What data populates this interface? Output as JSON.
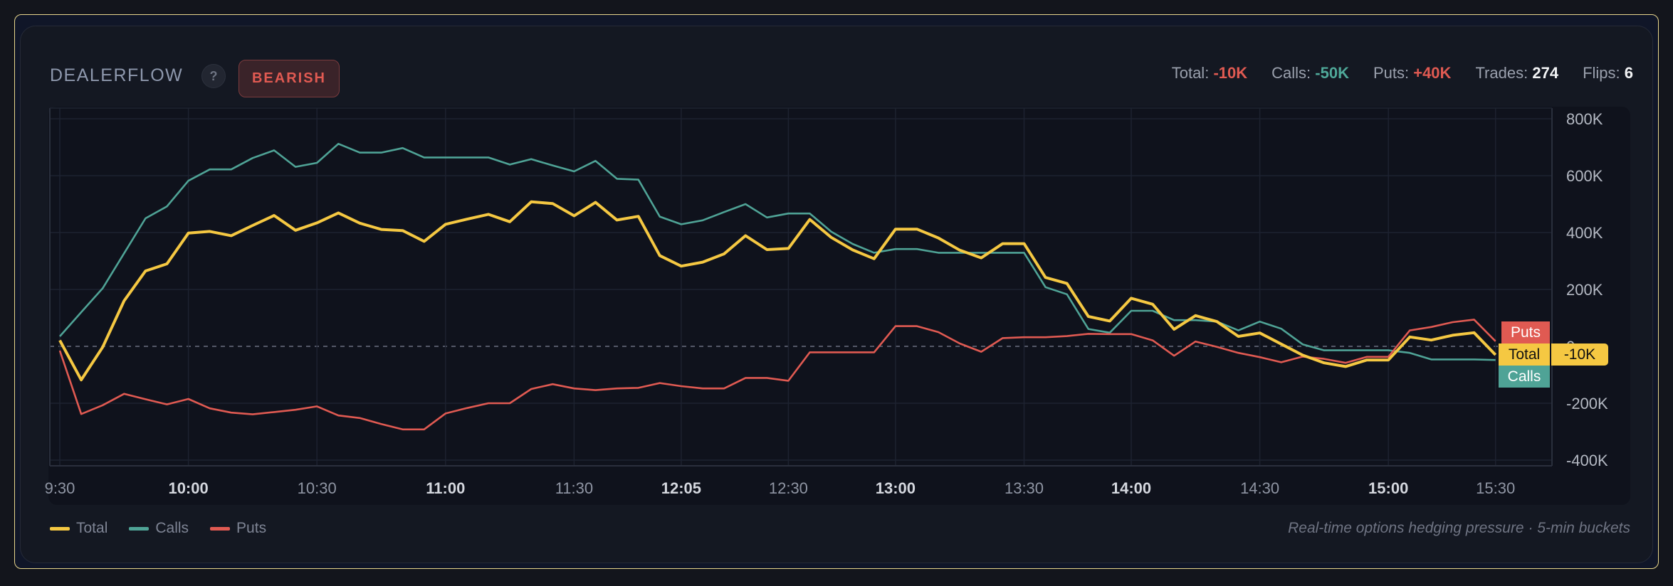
{
  "header": {
    "title": "DEALERFLOW",
    "help_label": "?",
    "sentiment_badge": "BEARISH",
    "stats": [
      {
        "label": "Total:",
        "value": "-10K",
        "color": "#e05a52"
      },
      {
        "label": "Calls:",
        "value": "-50K",
        "color": "#4fa899"
      },
      {
        "label": "Puts:",
        "value": "+40K",
        "color": "#e05a52"
      },
      {
        "label": "Trades:",
        "value": "274",
        "color": "#f2f3f5"
      },
      {
        "label": "Flips:",
        "value": "6",
        "color": "#f2f3f5"
      }
    ]
  },
  "legend": [
    {
      "name": "Total",
      "color": "#f5c842"
    },
    {
      "name": "Calls",
      "color": "#4fa396"
    },
    {
      "name": "Puts",
      "color": "#e05a52"
    }
  ],
  "footer": "Real-time options hedging pressure · 5-min buckets",
  "end_labels": {
    "puts": "Puts",
    "total": "Total",
    "calls": "Calls",
    "total_value": "-10K"
  },
  "chart_data": {
    "type": "line",
    "title": "",
    "xlabel": "",
    "ylabel": "",
    "ylim": [
      -400,
      800
    ],
    "y_unit_suffix": "K",
    "y_ticks": [
      {
        "value": 800,
        "label": "800K"
      },
      {
        "value": 600,
        "label": "600K"
      },
      {
        "value": 400,
        "label": "400K"
      },
      {
        "value": 200,
        "label": "200K"
      },
      {
        "value": 0,
        "label": "0"
      },
      {
        "value": -200,
        "label": "-200K"
      },
      {
        "value": -400,
        "label": "-400K"
      }
    ],
    "x_ticks": [
      {
        "bucket": 0,
        "label": "9:30",
        "bold": false
      },
      {
        "bucket": 6,
        "label": "10:00",
        "bold": true
      },
      {
        "bucket": 12,
        "label": "10:30",
        "bold": false
      },
      {
        "bucket": 18,
        "label": "11:00",
        "bold": true
      },
      {
        "bucket": 24,
        "label": "11:30",
        "bold": false
      },
      {
        "bucket": 29,
        "label": "12:05",
        "bold": true
      },
      {
        "bucket": 34,
        "label": "12:30",
        "bold": false
      },
      {
        "bucket": 39,
        "label": "13:00",
        "bold": true
      },
      {
        "bucket": 45,
        "label": "13:30",
        "bold": false
      },
      {
        "bucket": 50,
        "label": "14:00",
        "bold": true
      },
      {
        "bucket": 56,
        "label": "14:30",
        "bold": false
      },
      {
        "bucket": 62,
        "label": "15:00",
        "bold": true
      },
      {
        "bucket": 67,
        "label": "15:30",
        "bold": false
      }
    ],
    "zero_line": "dashed",
    "grid": true,
    "legend_position": "bottom-left",
    "series": [
      {
        "name": "Total",
        "color": "#f5c842",
        "values": [
          21,
          -118,
          -3,
          160,
          265,
          290,
          398,
          404,
          389,
          425,
          460,
          408,
          434,
          469,
          433,
          411,
          407,
          369,
          429,
          447,
          464,
          438,
          508,
          502,
          459,
          506,
          444,
          457,
          319,
          282,
          296,
          325,
          389,
          340,
          344,
          446,
          383,
          339,
          308,
          412,
          412,
          381,
          338,
          311,
          361,
          361,
          242,
          221,
          105,
          89,
          169,
          148,
          60,
          108,
          87,
          35,
          47,
          8,
          -31,
          -58,
          -71,
          -48,
          -48,
          33,
          22,
          39,
          48,
          -30
        ]
      },
      {
        "name": "Calls",
        "color": "#4fa396",
        "values": [
          35,
          120,
          204,
          327,
          450,
          492,
          582,
          622,
          622,
          662,
          689,
          631,
          645,
          712,
          681,
          681,
          697,
          664,
          664,
          664,
          664,
          639,
          658,
          636,
          615,
          652,
          589,
          586,
          456,
          429,
          443,
          472,
          500,
          453,
          467,
          467,
          403,
          360,
          329,
          342,
          342,
          329,
          329,
          329,
          329,
          329,
          208,
          183,
          61,
          48,
          125,
          125,
          92,
          92,
          87,
          56,
          87,
          62,
          7,
          -14,
          -14,
          -14,
          -14,
          -23,
          -46,
          -46,
          -46,
          -48
        ]
      },
      {
        "name": "Puts",
        "color": "#e05a52",
        "values": [
          -15,
          -238,
          -207,
          -167,
          -186,
          -204,
          -185,
          -218,
          -233,
          -239,
          -231,
          -223,
          -211,
          -243,
          -252,
          -273,
          -292,
          -292,
          -236,
          -217,
          -200,
          -200,
          -150,
          -133,
          -148,
          -154,
          -148,
          -146,
          -129,
          -140,
          -148,
          -148,
          -111,
          -111,
          -121,
          -21,
          -21,
          -21,
          -21,
          71,
          71,
          50,
          10,
          -19,
          29,
          32,
          32,
          36,
          44,
          43,
          43,
          21,
          -33,
          17,
          -2,
          -23,
          -38,
          -56,
          -36,
          -44,
          -58,
          -37,
          -37,
          56,
          68,
          85,
          94,
          18
        ]
      }
    ]
  }
}
